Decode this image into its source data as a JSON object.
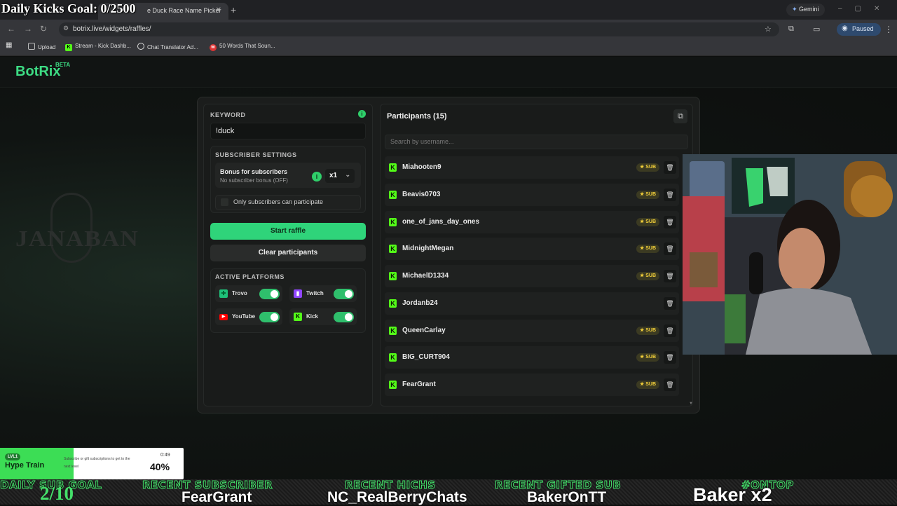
{
  "overlay": {
    "goal_text": "Daily Kicks Goal: 0/2500"
  },
  "browser": {
    "tab_title": "e Duck Race Name Picker",
    "tab_close": "✕",
    "new_tab": "+",
    "gemini_label": "Gemini",
    "url": "botrix.live/widgets/raffles/",
    "profile_status": "Paused",
    "bookmarks": [
      {
        "label": "Upload",
        "icon": "folder-icon"
      },
      {
        "label": "Stream - Kick Dashb...",
        "icon": "kick-icon"
      },
      {
        "label": "Chat Translator Ad...",
        "icon": "globe-icon"
      },
      {
        "label": "50 Words That Soun...",
        "icon": "wf-icon"
      }
    ]
  },
  "app": {
    "brand": "BotRix",
    "brand_badge": "BETA",
    "watermark": "JANABAN",
    "accent": "#3ddc84"
  },
  "raffle": {
    "keyword_label": "KEYWORD",
    "keyword_value": "!duck",
    "subscriber_settings_label": "SUBSCRIBER SETTINGS",
    "bonus_title": "Bonus for subscribers",
    "bonus_subtitle": "No subscriber bonus (OFF)",
    "multiplier": "x1",
    "only_subs_label": "Only subscribers can participate",
    "start_label": "Start raffle",
    "clear_label": "Clear participants",
    "platforms_label": "ACTIVE PLATFORMS",
    "platforms": [
      {
        "name": "Trovo",
        "enabled": true
      },
      {
        "name": "Twitch",
        "enabled": true
      },
      {
        "name": "YouTube",
        "enabled": true
      },
      {
        "name": "Kick",
        "enabled": true
      }
    ]
  },
  "participants": {
    "title": "Participants (15)",
    "search_placeholder": "Search by username...",
    "sub_badge": "SUB",
    "rows": [
      {
        "name": "Miahooten9",
        "sub": true
      },
      {
        "name": "Beavis0703",
        "sub": true
      },
      {
        "name": "one_of_jans_day_ones",
        "sub": true
      },
      {
        "name": "MidnightMegan",
        "sub": true
      },
      {
        "name": "MichaelD1334",
        "sub": true
      },
      {
        "name": "Jordanb24",
        "sub": false
      },
      {
        "name": "QueenCarlay",
        "sub": true
      },
      {
        "name": "BIG_CURT904",
        "sub": true
      },
      {
        "name": "FearGrant",
        "sub": true
      }
    ]
  },
  "hype_train": {
    "level": "LVL1",
    "title": "Hype Train",
    "description": "Subscribe or gift subscriptions to get to the next level",
    "time": "0:49",
    "percent": "40%",
    "progress": 0.4
  },
  "ticker": {
    "daily_sub_goal_label": "DAILY SUB GOAL",
    "daily_sub_goal_value": "2/10",
    "recent_subscriber_label": "RECENT SUBSCRIBER",
    "recent_subscriber_value": "FearGrant",
    "recent_hichs_label": "RECENT HICHS",
    "recent_hichs_value": "NC_RealBerryChats",
    "recent_gifted_label": "RECENT GIFTED SUB",
    "recent_gifted_value": "BakerOnTT",
    "ontop_label": "#ONTOP",
    "ontop_value": "Baker x2"
  }
}
